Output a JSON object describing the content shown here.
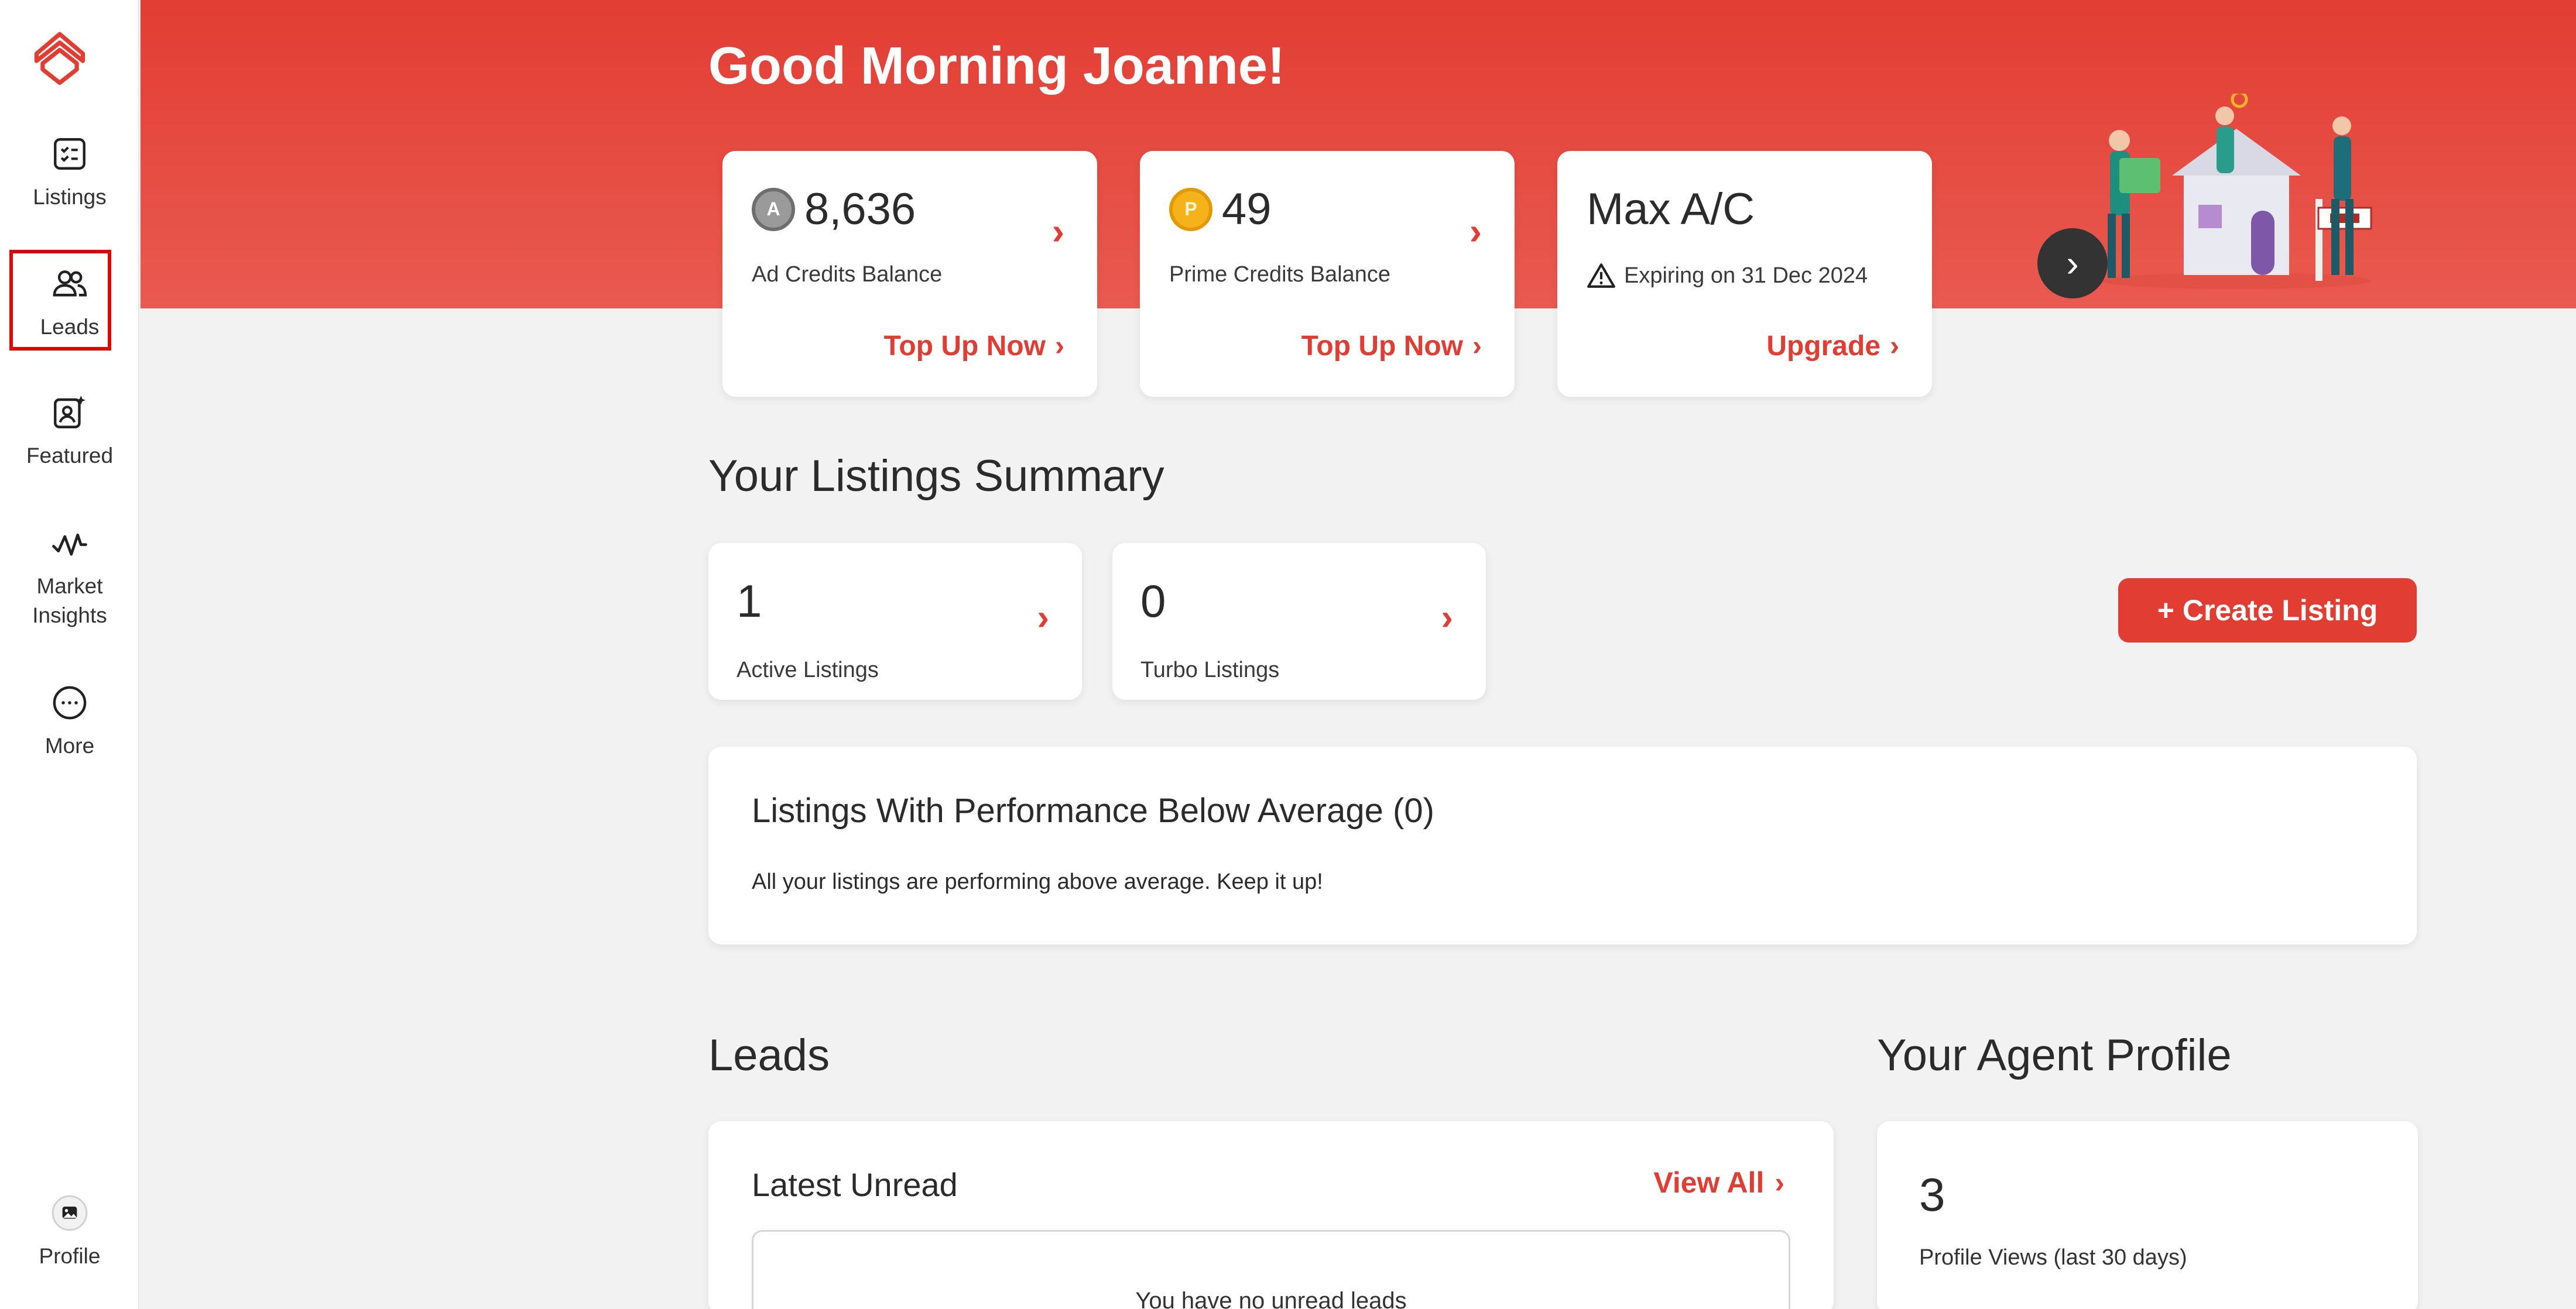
{
  "sidebar": {
    "items": [
      {
        "label": "Listings"
      },
      {
        "label": "Leads"
      },
      {
        "label": "Featured"
      },
      {
        "label": "Market Insights"
      },
      {
        "label": "More"
      }
    ],
    "profile_label": "Profile"
  },
  "hero": {
    "greeting": "Good Morning Joanne!",
    "cards": [
      {
        "value": "8,636",
        "label": "Ad Credits Balance",
        "link": "Top Up Now",
        "coin": "A"
      },
      {
        "value": "49",
        "label": "Prime Credits Balance",
        "link": "Top Up Now",
        "coin": "P"
      },
      {
        "value": "Max A/C",
        "label": "Expiring on 31 Dec 2024",
        "link": "Upgrade"
      }
    ]
  },
  "listings_summary": {
    "title": "Your Listings Summary",
    "cards": [
      {
        "value": "1",
        "label": "Active Listings"
      },
      {
        "value": "0",
        "label": "Turbo Listings"
      }
    ],
    "create_button": "+ Create Listing"
  },
  "performance": {
    "title": "Listings With Performance Below Average (0)",
    "message": "All your listings are performing above average. Keep it up!"
  },
  "leads": {
    "title": "Leads",
    "card_title": "Latest Unread",
    "view_all": "View All",
    "empty_text": "You have no unread leads"
  },
  "agent_profile": {
    "title": "Your Agent Profile",
    "value": "3",
    "label": "Profile Views (last 30 days)"
  },
  "colors": {
    "accent": "#e23d33",
    "highlight_box": "#e60000"
  }
}
